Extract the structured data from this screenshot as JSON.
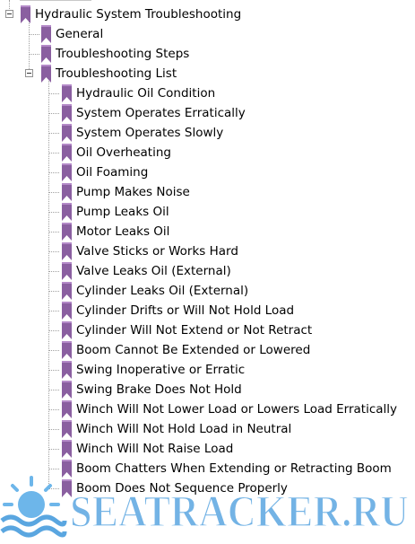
{
  "tree": {
    "root": {
      "label": "Hydraulic System Troubleshooting",
      "expanded": true
    },
    "children": [
      {
        "label": "General"
      },
      {
        "label": "Troubleshooting Steps"
      },
      {
        "label": "Troubleshooting List",
        "expanded": true
      }
    ],
    "list_items": [
      "Hydraulic Oil Condition",
      "System Operates Erratically",
      "System Operates Slowly",
      "Oil Overheating",
      "Oil Foaming",
      "Pump Makes Noise",
      "Pump Leaks Oil",
      "Motor Leaks Oil",
      "Valve Sticks or Works Hard",
      "Valve Leaks Oil (External)",
      "Cylinder Leaks Oil (External)",
      "Cylinder Drifts or Will Not Hold Load",
      "Cylinder Will Not Extend or Not Retract",
      "Boom Cannot Be Extended or Lowered",
      "Swing Inoperative or Erratic",
      "Swing Brake Does Not Hold",
      "Winch Will Not Lower Load or Lowers Load Erratically",
      "Winch Will Not Hold Load in Neutral",
      "Winch Will Not Raise Load",
      "Boom Chatters When Extending or Retracting Boom",
      "Boom Does Not Sequence Properly"
    ]
  },
  "watermark": {
    "text": "SEATRACKER.RU",
    "logo": "sun-waves-logo",
    "color": "#5aa6e0"
  },
  "icons": {
    "bookmark": "bookmark-icon",
    "color": "#8a5fa0"
  }
}
